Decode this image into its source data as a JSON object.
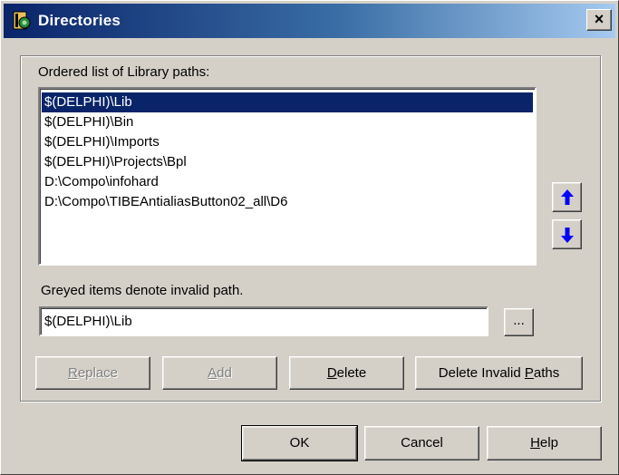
{
  "window": {
    "title": "Directories",
    "close_label": "×"
  },
  "list": {
    "label": "Ordered list of Library paths:",
    "items": [
      "$(DELPHI)\\Lib",
      "$(DELPHI)\\Bin",
      "$(DELPHI)\\Imports",
      "$(DELPHI)\\Projects\\Bpl",
      "D:\\Compo\\infohard",
      "D:\\Compo\\TIBEAntialiasButton02_all\\D6"
    ],
    "selected_index": 0
  },
  "hint": "Greyed items denote invalid path.",
  "path_field": {
    "value": "$(DELPHI)\\Lib",
    "browse_label": "..."
  },
  "buttons": {
    "replace": {
      "mnemonic": "R",
      "rest": "eplace"
    },
    "add": {
      "mnemonic": "A",
      "rest": "dd"
    },
    "delete": {
      "mnemonic": "D",
      "rest": "elete"
    },
    "delete_invalid": {
      "prefix": "Delete Invalid ",
      "mnemonic": "P",
      "rest": "aths"
    },
    "ok": "OK",
    "cancel": "Cancel",
    "help": {
      "mnemonic": "H",
      "rest": "elp"
    }
  },
  "colors": {
    "selection": "#0a246a",
    "arrow": "#0000ff",
    "face": "#d4d0c8"
  },
  "icons": {
    "app": "directories-app-icon",
    "move_up": "arrow-up-icon",
    "move_down": "arrow-down-icon"
  }
}
